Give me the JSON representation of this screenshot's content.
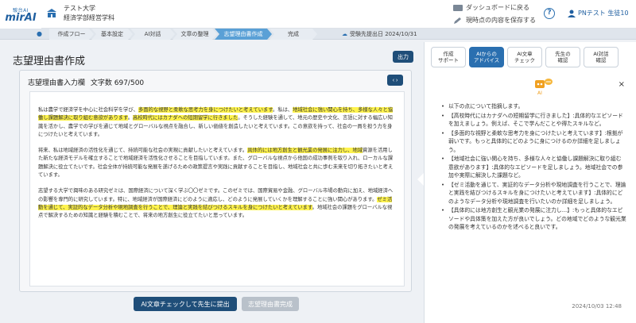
{
  "header": {
    "logo_top": "駿台AI",
    "logo_main": "mirAI",
    "school": "テスト大学",
    "department": "経済学部経営学科",
    "dashboard_link": "ダッシュボードに戻る",
    "save_link": "現時点の内容を保存する",
    "help": "?",
    "user": "PNテスト 生徒10"
  },
  "steps": {
    "flow_label": "作成フロー",
    "items": [
      "基本設定",
      "AI対話",
      "文章の整理",
      "志望理由書作成",
      "完成"
    ],
    "deadline": "受験先提出日 2024/10/31"
  },
  "main": {
    "title": "志望理由書作成",
    "output_label": "出力",
    "editor_title": "志望理由書入力欄",
    "char_count": "文字数 697/500",
    "toggle": "‹ ›",
    "p1a": "私は農学で経済学を中心に社会科学を学び、",
    "p1b": "多面的な視野と柔軟な思考力を身につけたいと考えています",
    "p1c": "。私は、",
    "p1d": "地域社会に強い関心を持ち、多様な人々と協働し課題解決に取り組む意欲があります",
    "p1e": "。",
    "p1f": "高校時代にはカナダへの短期留学に行きました",
    "p1g": "。そうした経験を通して、地元の歴史や文化、言語に対する幅広い知識を活かし、農学での学びを通じて地域とグローバルな視点を融合し、新しい価値を創造したいと考えています。この意欲を持って、社会の一員を担う力を身につけたいと考えています。",
    "p2a": "将来、私は地域経済の活性化を通じて、持続可能な社会の実現に貢献したいと考えています。",
    "p2b": "具体的には地方創生と観光業の発展に注力し、地域",
    "p2c": "資源を活用した新たな経済モデルを確立することで地域経済を活性化させることを目指しています。また、グローバルな視点から他国の成功事例を取り入れ、ローカルな課題解決に役立てたいです。社会全体が持続可能な発展を遂げるための政策提言や実践に貢献することを目指し、地域社会と共に歩む未来を切り拓きたいと考えています。",
    "p3a": "志望する大学で興味のある研究ゼミは、国際経済について深く学ぶ〇〇ゼミです。このゼミでは、国際貿易や金融、グローバル市場の動向に加え、地域経済への影響を専門的に研究しています。特に、地域経済が国際経済にどのように適応し、どのように発展していくかを理解することに強い関心があります。",
    "p3b": "ゼミ活動を通じて、実証的なデータ分析や現地調査を行うことで、理論と実践を結びつけるスキルを身につけたいと考えています",
    "p3c": "。地域社会の課題をグローバルな視点で解決するための知識と経験を積むことで、将来の地方創生に役立てたいと思っています。",
    "submit_label": "AI文章チェックして先生に提出",
    "complete_label": "志望理由書完成"
  },
  "side": {
    "tabs": [
      {
        "l1": "作成",
        "l2": "サポート"
      },
      {
        "l1": "AIからの",
        "l2": "アドバイス"
      },
      {
        "l1": "AI文章",
        "l2": "チェック"
      },
      {
        "l1": "先生の",
        "l2": "確認"
      },
      {
        "l1": "AI対話",
        "l2": "確認"
      }
    ],
    "ai_badge": "AI",
    "close": "×",
    "advice": [
      "以下の点について指摘します。",
      "【高校時代にはカナダへの短期留学に行きました】:具体的なエピソードを加えましょう。例えば、そこで学んだことや得たスキルなど。",
      "【多面的な視野と柔軟な思考力を身につけたいと考えています】:根拠が弱いです。もっと具体的にどのように身につけるのか詳細を足しましょう。",
      "【地域社会に強い関心を持ち、多様な人々と協働し課題解決に取り組む意欲があります】:具体的なエピソードを足しましょう。地域社会での参加や実際に解決した課題など。",
      "【ゼミ活動を通じて、実証的なデータ分析や現地調査を行うことで、理論と実践を結びつけるスキルを身につけたいと考えています】:具体的にどのようなデータ分析や現地調査を行いたいのか詳細を足しましょう。",
      "【具体的には地方創生と観光業の発展に注力し...】:もっと具体的なエピソードや具体策を加えた方が良いでしょう。どの地域でどのような観光業の発展を考えているのかを述べると良いです。"
    ],
    "timestamp": "2024/10/03 12:48"
  }
}
